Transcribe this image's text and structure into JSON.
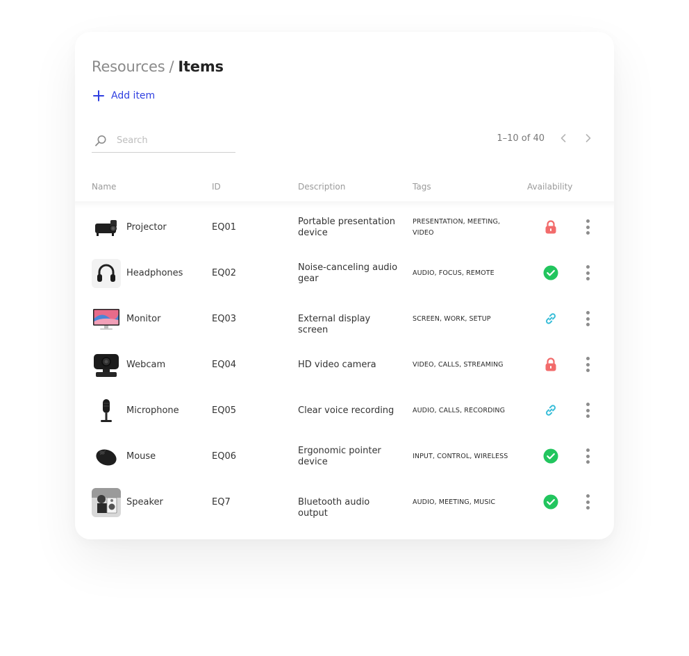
{
  "breadcrumb": {
    "parent": "Resources",
    "separator": "/",
    "current": "Items"
  },
  "actions": {
    "add_label": "Add item"
  },
  "search": {
    "placeholder": "Search"
  },
  "pagination": {
    "range": "1–10 of 40"
  },
  "columns": {
    "name": "Name",
    "id": "ID",
    "description": "Description",
    "tags": "Tags",
    "availability": "Availability"
  },
  "colors": {
    "accent": "#2f3fe0",
    "locked": "#f26b6b",
    "available": "#22c55e",
    "linked": "#38bdd8"
  },
  "rows": [
    {
      "name": "Projector",
      "id": "EQ01",
      "description": [
        "Portable presentation",
        "device"
      ],
      "tags": [
        "PRESENTATION, MEETING,",
        "VIDEO"
      ],
      "availability": "lock-icon",
      "thumb": "projector-thumb"
    },
    {
      "name": "Headphones",
      "id": "EQ02",
      "description": [
        "Noise-canceling audio",
        "gear"
      ],
      "tags": [
        "AUDIO, FOCUS, REMOTE"
      ],
      "availability": "check-circle-icon",
      "thumb": "headphones-thumb"
    },
    {
      "name": "Monitor",
      "id": "EQ03",
      "description": [
        "External display screen"
      ],
      "tags": [
        "SCREEN, WORK, SETUP"
      ],
      "availability": "link-icon",
      "thumb": "monitor-thumb"
    },
    {
      "name": "Webcam",
      "id": "EQ04",
      "description": [
        "HD video camera"
      ],
      "tags": [
        "VIDEO, CALLS, STREAMING"
      ],
      "availability": "lock-icon",
      "thumb": "webcam-thumb"
    },
    {
      "name": "Microphone",
      "id": "EQ05",
      "description": [
        "Clear voice recording"
      ],
      "tags": [
        "AUDIO, CALLS, RECORDING"
      ],
      "availability": "link-icon",
      "thumb": "microphone-thumb"
    },
    {
      "name": "Mouse",
      "id": "EQ06",
      "description": [
        "Ergonomic pointer",
        "device"
      ],
      "tags": [
        "INPUT, CONTROL, WIRELESS"
      ],
      "availability": "check-circle-icon",
      "thumb": "mouse-thumb"
    },
    {
      "name": "Speaker",
      "id": "EQ7",
      "description": [
        "Bluetooth audio output"
      ],
      "tags": [
        "AUDIO, MEETING, MUSIC"
      ],
      "availability": "check-circle-icon",
      "thumb": "speaker-thumb"
    }
  ]
}
